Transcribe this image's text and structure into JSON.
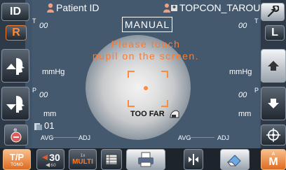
{
  "header": {
    "patient_id_label": "Patient ID",
    "patient_name": "TOPCON_TAROU"
  },
  "left_panel": {
    "id_button": "ID",
    "r_button": "R"
  },
  "right_panel": {
    "l_button": "L"
  },
  "mode": {
    "label": "MANUAL"
  },
  "message": {
    "line1": "Please touch",
    "line2": "pupil on the screen."
  },
  "measurements": {
    "top_left_T_label": "T",
    "top_left_T_value": "00",
    "top_right_T_value": "00",
    "top_right_T_label": "T",
    "left_unit_mmHg": "mmHg",
    "right_unit_mmHg": "mmHg",
    "left_P_label": "P",
    "left_P_value": "00",
    "right_P_value": "00",
    "right_P_label": "P",
    "left_unit_mm": "mm",
    "right_unit_mm": "mm",
    "count": "01",
    "avg_left": "AVG",
    "adj_left": "ADJ",
    "avg_center": "AVG",
    "adj_right": "ADJ"
  },
  "alignment": {
    "too_far": "TOO FAR"
  },
  "toolbar": {
    "tp_top": "T/P",
    "tp_sub": "TONO",
    "threshold_value": "30",
    "threshold_sub": "60",
    "multi_top": "1x",
    "multi_label": "MULTI",
    "m_sup": "A",
    "m_label": "M"
  },
  "colors": {
    "accent_orange": "#e06a1e",
    "background": "#44596d"
  }
}
